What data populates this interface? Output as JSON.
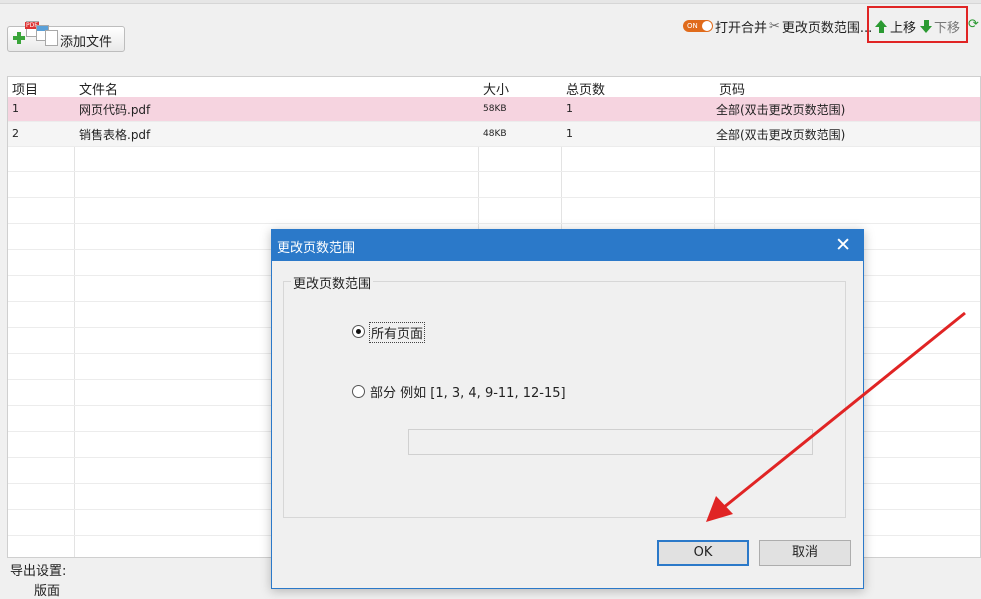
{
  "toolbar": {
    "add_file": "添加文件",
    "toggle_on": "ON",
    "open_merge": "打开合并",
    "change_range": "更改页数范围...",
    "move_up": "上移",
    "move_down": "下移"
  },
  "table": {
    "headers": [
      "项目",
      "文件名",
      "大小",
      "总页数",
      "页码"
    ],
    "rows": [
      {
        "index": "1",
        "name": "网页代码.pdf",
        "size": "58KB",
        "pages": "1",
        "range": "全部(双击更改页数范围)"
      },
      {
        "index": "2",
        "name": "销售表格.pdf",
        "size": "48KB",
        "pages": "1",
        "range": "全部(双击更改页数范围)"
      }
    ]
  },
  "export": {
    "label": "导出设置:",
    "sub_label": "版面"
  },
  "dialog": {
    "title": "更改页数范围",
    "close": "✕",
    "group_label": "更改页数范围",
    "option_all": "所有页面",
    "option_partial": "部分 例如 [1, 3, 4, 9-11, 12-15]",
    "range_value": "",
    "ok": "OK",
    "cancel": "取消"
  },
  "colors": {
    "accent": "#2b79c9",
    "highlight": "#e02424",
    "selected_row": "#f6d4e0",
    "arrow_green": "#2b9a32"
  },
  "icons": [
    "add-plus-icon",
    "pdf-files-icon",
    "toggle-icon",
    "wrench-icon",
    "arrow-up-icon",
    "arrow-down-icon",
    "refresh-icon",
    "close-icon"
  ]
}
